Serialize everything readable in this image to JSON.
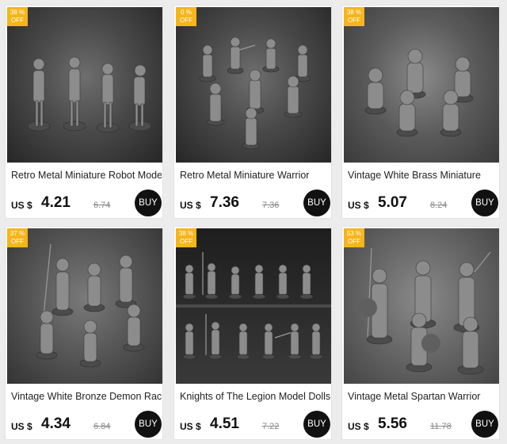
{
  "products": [
    {
      "badge": {
        "percent": "38 %",
        "off": "OFF"
      },
      "title": "Retro Metal Miniature Robot Model",
      "currency": "US $",
      "price": "4.21",
      "old_price": "6.74",
      "buy_label": "BUY"
    },
    {
      "badge": {
        "percent": "0 %",
        "off": "OFF"
      },
      "title": "Retro Metal Miniature Warrior",
      "currency": "US $",
      "price": "7.36",
      "old_price": "7.36",
      "buy_label": "BUY"
    },
    {
      "badge": {
        "percent": "38 %",
        "off": "OFF"
      },
      "title": "Vintage White Brass Miniature",
      "currency": "US $",
      "price": "5.07",
      "old_price": "8.24",
      "buy_label": "BUY"
    },
    {
      "badge": {
        "percent": "37 %",
        "off": "OFF"
      },
      "title": "Vintage White Bronze Demon Race",
      "currency": "US $",
      "price": "4.34",
      "old_price": "6.84",
      "buy_label": "BUY"
    },
    {
      "badge": {
        "percent": "38 %",
        "off": "OFF"
      },
      "title": "Knights of The Legion Model Dolls",
      "currency": "US $",
      "price": "4.51",
      "old_price": "7.22",
      "buy_label": "BUY"
    },
    {
      "badge": {
        "percent": "53 %",
        "off": "OFF"
      },
      "title": "Vintage Metal Spartan Warrior",
      "currency": "US $",
      "price": "5.56",
      "old_price": "11.78",
      "buy_label": "BUY"
    }
  ],
  "colors": {
    "badge": "#f5b51b",
    "buy_button": "#111111",
    "page_background": "#ececec"
  }
}
